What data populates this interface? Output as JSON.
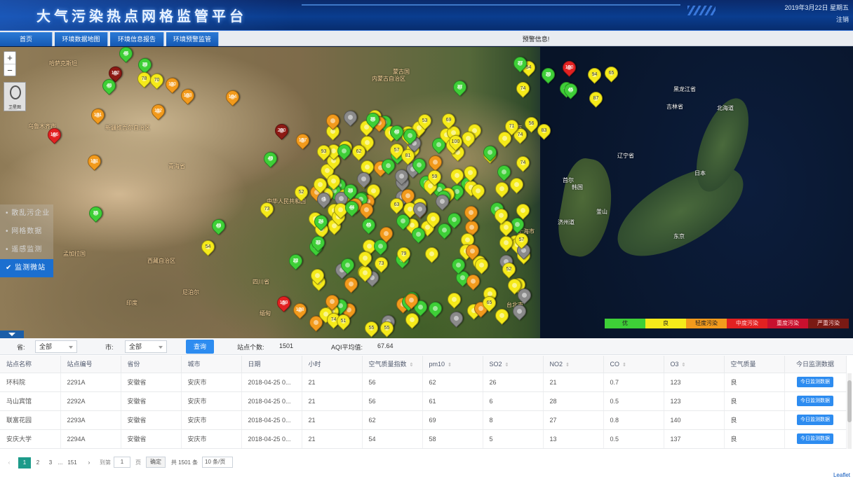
{
  "header": {
    "title": "大气污染热点网格监管平台",
    "date": "2019年3月22日 星期五",
    "logout": "注销"
  },
  "nav": {
    "tabs": [
      "首页",
      "环境数据地图",
      "环境信息报告",
      "环境预警监管"
    ],
    "alert": "预警信息!"
  },
  "map": {
    "zoom_in": "+",
    "zoom_out": "−",
    "thumbnail_label": "卫星图",
    "labels": [
      {
        "text": "哈萨克斯坦"
      },
      {
        "text": "蒙古国"
      },
      {
        "text": "乌鲁木齐市"
      },
      {
        "text": "新疆维吾尔自治区"
      },
      {
        "text": "内蒙古自治区"
      },
      {
        "text": "青海省"
      },
      {
        "text": "西藏自治区"
      },
      {
        "text": "四川省"
      },
      {
        "text": "中华人民共和国"
      },
      {
        "text": "印度"
      },
      {
        "text": "尼泊尔"
      },
      {
        "text": "孟加拉国"
      },
      {
        "text": "缅甸"
      },
      {
        "text": "北京市"
      },
      {
        "text": "辽宁省"
      },
      {
        "text": "吉林省"
      },
      {
        "text": "黑龙江省"
      },
      {
        "text": "北海道"
      },
      {
        "text": "日本"
      },
      {
        "text": "韩国"
      },
      {
        "text": "首尔"
      },
      {
        "text": "东京"
      },
      {
        "text": "台北市"
      },
      {
        "text": "上海市"
      },
      {
        "text": "济州道"
      },
      {
        "text": "釜山"
      }
    ],
    "side_menu": [
      "散乱污企业",
      "网格数据",
      "遥感监测",
      "监测微站"
    ],
    "side_active_index": 3,
    "legend": [
      {
        "label": "优",
        "color": "#3ecf37"
      },
      {
        "label": "良",
        "color": "#f5ea1a"
      },
      {
        "label": "轻度污染",
        "color": "#f29a1c"
      },
      {
        "label": "中度污染",
        "color": "#e22121"
      },
      {
        "label": "重度污染",
        "color": "#c8102e"
      },
      {
        "label": "严重污染",
        "color": "#7a1a14"
      }
    ],
    "markers": [
      {
        "v": "46",
        "c": "good"
      },
      {
        "v": "102",
        "c": "heavy"
      },
      {
        "v": "39",
        "c": "good"
      },
      {
        "v": "78",
        "c": "fair"
      },
      {
        "v": "70",
        "c": "fair"
      },
      {
        "v": "110",
        "c": "light"
      },
      {
        "v": "40",
        "c": "good"
      },
      {
        "v": "103",
        "c": "light"
      },
      {
        "v": "104",
        "c": "light"
      },
      {
        "v": "112",
        "c": "light"
      },
      {
        "v": "131",
        "c": "light"
      },
      {
        "v": "166",
        "c": "moderate"
      },
      {
        "v": "200",
        "c": "heavy"
      },
      {
        "v": "157",
        "c": "light"
      },
      {
        "v": "131",
        "c": "light"
      },
      {
        "v": "49",
        "c": "good"
      },
      {
        "v": "35",
        "c": "good"
      },
      {
        "v": "73",
        "c": "fair"
      },
      {
        "v": "52",
        "c": "fair"
      },
      {
        "v": "54",
        "c": "fair"
      },
      {
        "v": "49",
        "c": "good"
      },
      {
        "v": "37",
        "c": "good"
      },
      {
        "v": "36",
        "c": "good"
      },
      {
        "v": "40",
        "c": "good"
      },
      {
        "v": "62",
        "c": "fair"
      },
      {
        "v": "53",
        "c": "fair"
      },
      {
        "v": "69",
        "c": "fair"
      },
      {
        "v": "57",
        "c": "fair"
      },
      {
        "v": "93",
        "c": "fair"
      },
      {
        "v": "81",
        "c": "fair"
      },
      {
        "v": "74",
        "c": "fair"
      },
      {
        "v": "38",
        "c": "good"
      },
      {
        "v": "44",
        "c": "good"
      },
      {
        "v": "45",
        "c": "good"
      },
      {
        "v": "24",
        "c": "good"
      },
      {
        "v": "32",
        "c": "good"
      },
      {
        "v": "-1",
        "c": "nodata"
      },
      {
        "v": "79",
        "c": "fair"
      },
      {
        "v": "22",
        "c": "good"
      },
      {
        "v": "159",
        "c": "moderate"
      },
      {
        "v": "128",
        "c": "light"
      },
      {
        "v": "74",
        "c": "fair"
      },
      {
        "v": "51",
        "c": "fair"
      },
      {
        "v": "55",
        "c": "fair"
      },
      {
        "v": "73",
        "c": "fair"
      },
      {
        "v": "100",
        "c": "fair"
      },
      {
        "v": "59",
        "c": "fair"
      },
      {
        "v": "65",
        "c": "fair"
      },
      {
        "v": "52",
        "c": "fair"
      },
      {
        "v": "57",
        "c": "fair"
      },
      {
        "v": "74",
        "c": "fair"
      },
      {
        "v": "74",
        "c": "fair"
      },
      {
        "v": "94",
        "c": "fair"
      },
      {
        "v": "87",
        "c": "fair"
      },
      {
        "v": "65",
        "c": "fair"
      },
      {
        "v": "55",
        "c": "fair"
      },
      {
        "v": "44",
        "c": "good"
      },
      {
        "v": "20",
        "c": "good"
      },
      {
        "v": "54",
        "c": "fair"
      },
      {
        "v": "27",
        "c": "good"
      },
      {
        "v": "100",
        "c": "moderate"
      },
      {
        "v": "63",
        "c": "fair"
      },
      {
        "v": "83",
        "c": "fair"
      },
      {
        "v": "56",
        "c": "fair"
      },
      {
        "v": "71",
        "c": "fair"
      },
      {
        "v": "45",
        "c": "good"
      }
    ]
  },
  "filter": {
    "province_label": "省:",
    "province_value": "全部",
    "city_label": "市:",
    "city_value": "全部",
    "query": "查询",
    "count_label": "站点个数:",
    "count_value": "1501",
    "aqi_label": "AQI平均值:",
    "aqi_value": "67.64"
  },
  "table": {
    "columns": [
      "站点名称",
      "站点编号",
      "省份",
      "城市",
      "日期",
      "小时",
      "空气质量指数",
      "pm10",
      "SO2",
      "NO2",
      "CO",
      "O3",
      "空气质量",
      "今日监测数据"
    ],
    "rows": [
      [
        "环科院",
        "2291A",
        "安徽省",
        "安庆市",
        "2018-04-25 0...",
        "21",
        "56",
        "62",
        "26",
        "21",
        "0.7",
        "123",
        "良"
      ],
      [
        "马山宾馆",
        "2292A",
        "安徽省",
        "安庆市",
        "2018-04-25 0...",
        "21",
        "56",
        "61",
        "6",
        "28",
        "0.5",
        "123",
        "良"
      ],
      [
        "联富花园",
        "2293A",
        "安徽省",
        "安庆市",
        "2018-04-25 0...",
        "21",
        "62",
        "69",
        "8",
        "27",
        "0.8",
        "140",
        "良"
      ],
      [
        "安庆大学",
        "2294A",
        "安徽省",
        "安庆市",
        "2018-04-25 0...",
        "21",
        "54",
        "58",
        "5",
        "13",
        "0.5",
        "137",
        "良"
      ]
    ],
    "row_button": "今日监测数据"
  },
  "pager": {
    "prev": "‹",
    "pages": [
      "1",
      "2",
      "3",
      "...",
      "151"
    ],
    "next": "›",
    "goto_label": "到第",
    "goto_value": "1",
    "page_unit": "页",
    "confirm": "确定",
    "total": "共 1501 条",
    "page_size": "10 条/页"
  },
  "leaflet": "Leaflet"
}
